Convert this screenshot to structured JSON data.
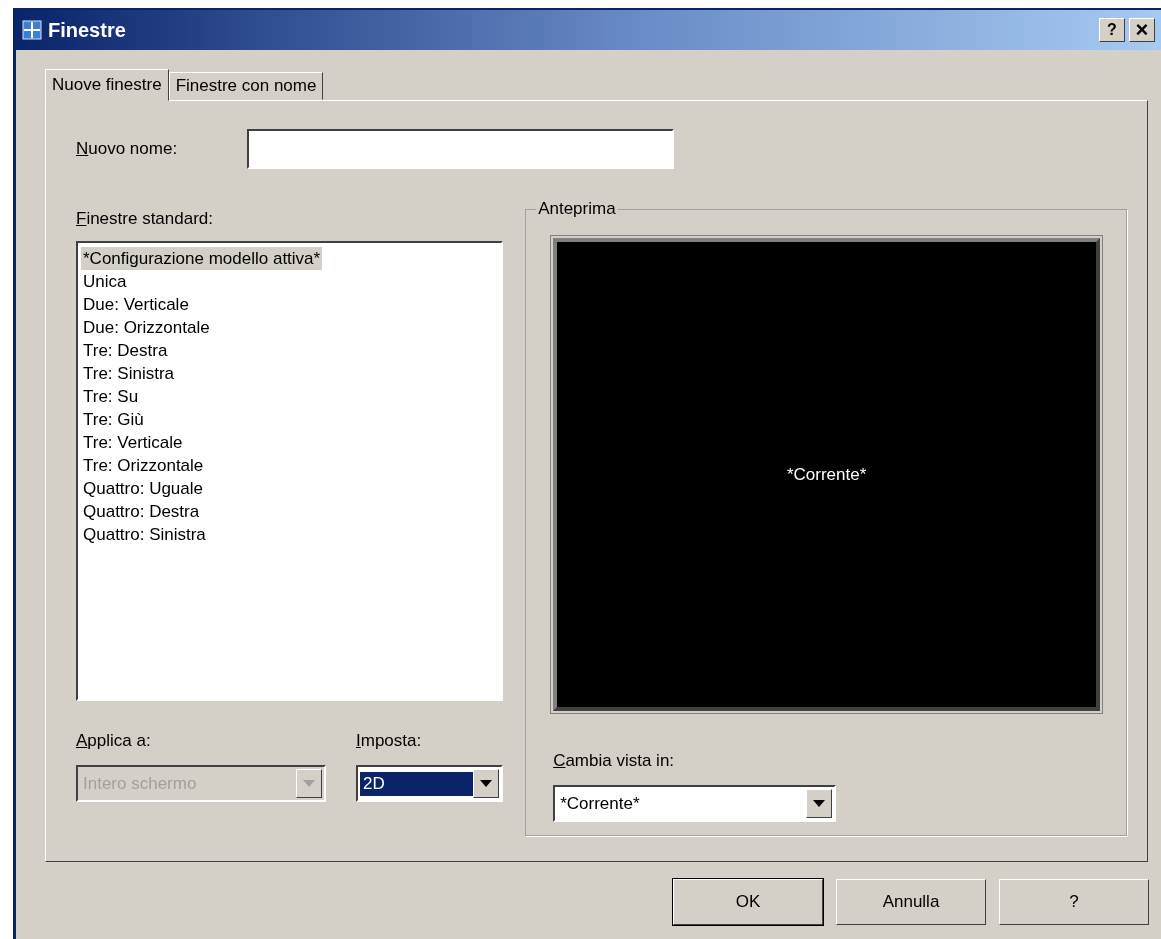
{
  "window": {
    "title": "Finestre",
    "buttons": [
      {
        "kind": "help",
        "label": "?"
      },
      {
        "kind": "close",
        "label": "×"
      }
    ]
  },
  "tabs": [
    {
      "label": "Nuove finestre",
      "selected": true
    },
    {
      "label": "Finestre con nome",
      "selected": false
    }
  ],
  "new_name": {
    "label": "Nuovo nome:"
  },
  "standard": {
    "label": "Finestre standard:",
    "items": [
      {
        "label": "*Configurazione modello attiva*",
        "selected": true
      },
      {
        "label": "Unica",
        "selected": false
      },
      {
        "label": "Due: Verticale",
        "selected": false
      },
      {
        "label": "Due: Orizzontale",
        "selected": false
      },
      {
        "label": "Tre: Destra",
        "selected": false
      },
      {
        "label": "Tre: Sinistra",
        "selected": false
      },
      {
        "label": "Tre: Su",
        "selected": false
      },
      {
        "label": "Tre: Giù",
        "selected": false
      },
      {
        "label": "Tre: Verticale",
        "selected": false
      },
      {
        "label": "Tre: Orizzontale",
        "selected": false
      },
      {
        "label": "Quattro: Uguale",
        "selected": false
      },
      {
        "label": "Quattro: Destra",
        "selected": false
      },
      {
        "label": "Quattro: Sinistra",
        "selected": false
      }
    ]
  },
  "combos": [
    {
      "label": "Applica a:",
      "value": "Intero schermo",
      "disabled": true,
      "highlighted": false
    },
    {
      "label": "Imposta:",
      "value": "2D",
      "disabled": false,
      "highlighted": true
    }
  ],
  "preview": {
    "title": "Anteprima",
    "caption": "*Corrente*",
    "change_label": "Cambia vista in:",
    "change_value": "*Corrente*"
  },
  "buttons": [
    {
      "label": "OK",
      "default": true
    },
    {
      "label": "Annulla",
      "default": false
    },
    {
      "label": "?",
      "default": false
    }
  ]
}
